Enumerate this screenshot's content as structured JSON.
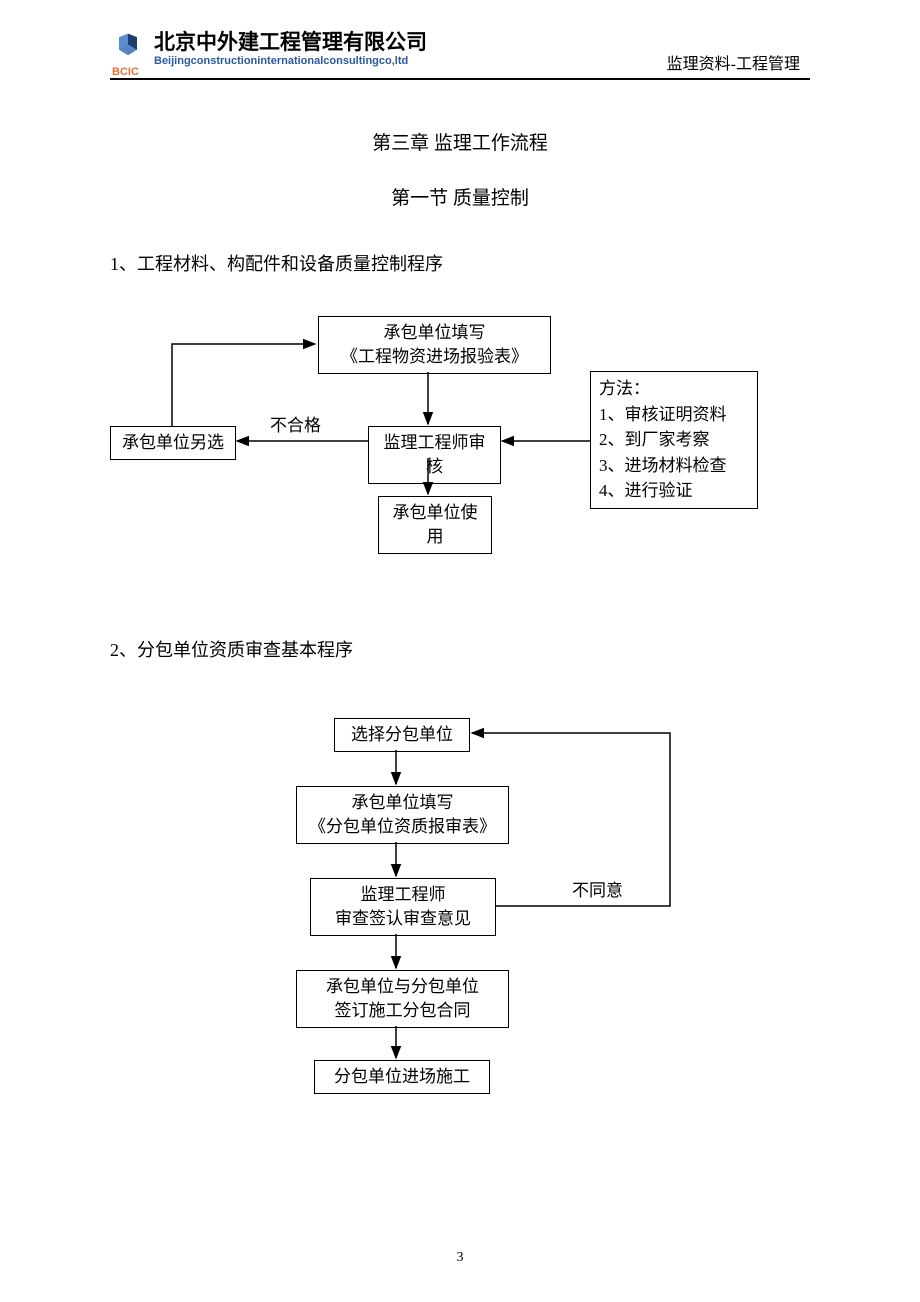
{
  "header": {
    "company_cn": "北京中外建工程管理有限公司",
    "company_en": "Beijingconstructioninternationalconsultingco,ltd",
    "bcic": "BCIC",
    "right": "监理资料-工程管理"
  },
  "chapter": "第三章  监理工作流程",
  "section": "第一节   质量控制",
  "item1": "1、工程材料、构配件和设备质量控制程序",
  "item2": "2、分包单位资质审查基本程序",
  "d1": {
    "top": "承包单位填写\n《工程物资进场报验表》",
    "review": "监理工程师审核",
    "use": "承包单位使用",
    "alt": "承包单位另选",
    "fail_label": "不合格",
    "method_title": "方法：",
    "method_1": "1、审核证明资料",
    "method_2": "2、到厂家考察",
    "method_3": "3、进场材料检查",
    "method_4": "4、进行验证"
  },
  "d2": {
    "select": "选择分包单位",
    "form": "承包单位填写\n《分包单位资质报审表》",
    "review": "监理工程师\n审查签认审查意见",
    "contract": "承包单位与分包单位\n签订施工分包合同",
    "enter": "分包单位进场施工",
    "disagree": "不同意"
  },
  "page_number": "3"
}
